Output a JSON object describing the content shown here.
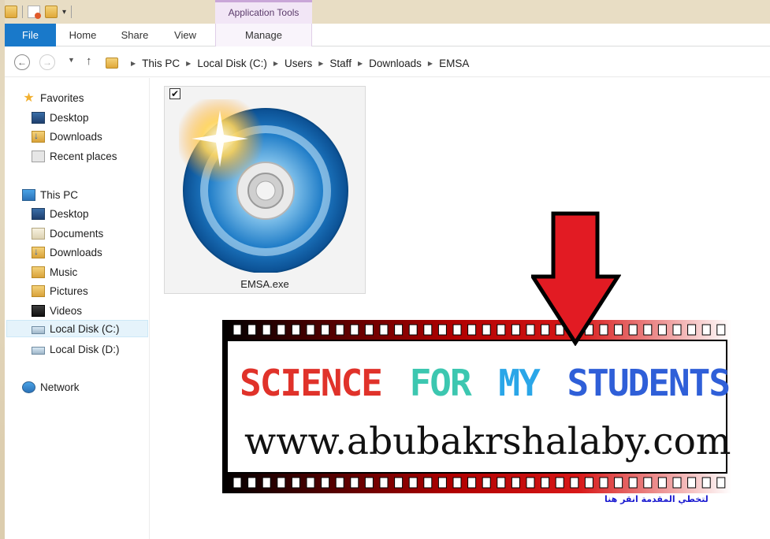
{
  "window": {
    "contextual_tab_group": "Application Tools"
  },
  "ribbon": {
    "tabs": [
      "File",
      "Home",
      "Share",
      "View",
      "Manage"
    ]
  },
  "address": {
    "crumbs": [
      "This PC",
      "Local Disk (C:)",
      "Users",
      "Staff",
      "Downloads",
      "EMSA"
    ]
  },
  "nav": {
    "favorites": "Favorites",
    "fav_items": [
      "Desktop",
      "Downloads",
      "Recent places"
    ],
    "this_pc": "This PC",
    "pc_items": [
      "Desktop",
      "Documents",
      "Downloads",
      "Music",
      "Pictures",
      "Videos",
      "Local Disk (C:)",
      "Local Disk (D:)"
    ],
    "selected": "Local Disk (C:)",
    "network": "Network"
  },
  "file": {
    "name": "EMSA.exe",
    "checked": true,
    "check_glyph": "✔"
  },
  "banner": {
    "title_words": [
      "SCIENCE",
      "FOR",
      "MY",
      "STUDENTS"
    ],
    "title_colors": [
      "#e0322a",
      "#3cc7b0",
      "#2aa6e8",
      "#2f5fd8"
    ],
    "url": "www.abubakrshalaby.com",
    "arabic_caption": "لتخطي المقدمة انقر هنا"
  },
  "icons": [
    "back-icon",
    "forward-icon",
    "up-icon",
    "folder-icon",
    "star-icon",
    "disc-icon",
    "arrow-down-icon"
  ]
}
